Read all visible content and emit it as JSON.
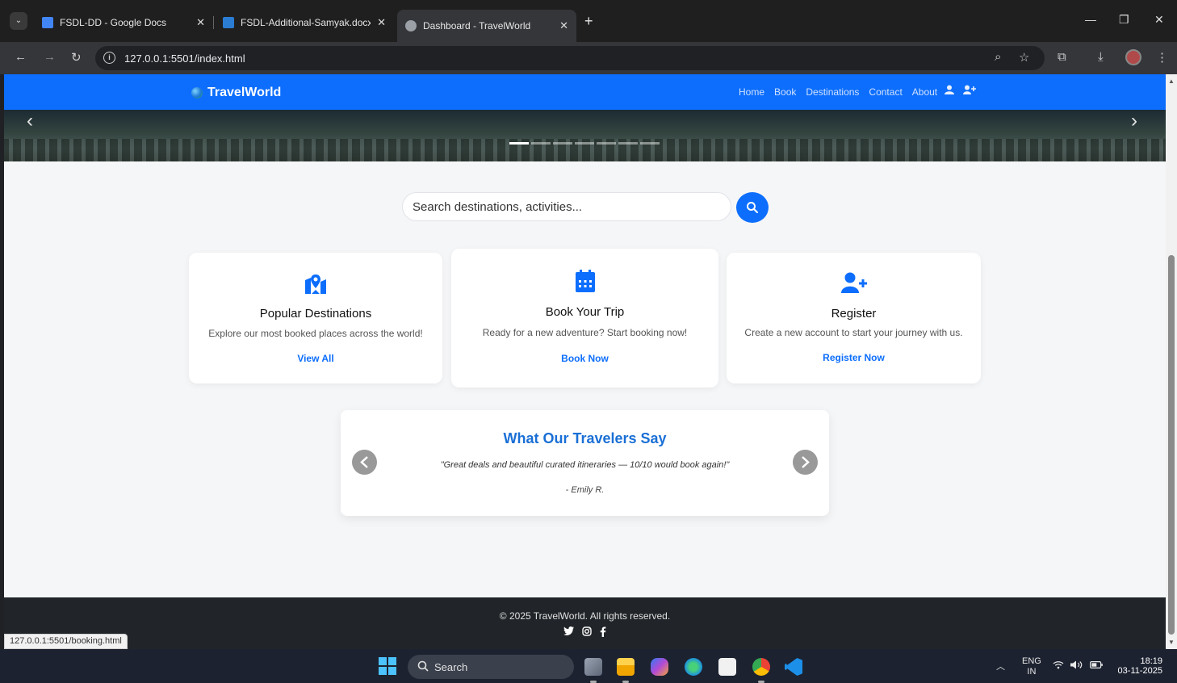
{
  "browser": {
    "tabs": [
      {
        "label": "FSDL-DD - Google Docs",
        "icon": "google-docs-icon"
      },
      {
        "label": "FSDL-Additional-Samyak.docx",
        "icon": "word-icon"
      },
      {
        "label": "Dashboard - TravelWorld",
        "icon": "globe-icon",
        "active": true
      }
    ],
    "url": "127.0.0.1:5501/index.html",
    "status_url": "127.0.0.1:5501/booking.html"
  },
  "page": {
    "brand": "TravelWorld",
    "nav": [
      "Home",
      "Book",
      "Destinations",
      "Contact",
      "About"
    ],
    "hero": {
      "slides": 7,
      "active_slide": 0
    },
    "search": {
      "placeholder": "Search destinations, activities..."
    },
    "cards": [
      {
        "icon": "map-location-icon",
        "title": "Popular Destinations",
        "text": "Explore our most booked places across the world!",
        "link": "View All"
      },
      {
        "icon": "calendar-icon",
        "title": "Book Your Trip",
        "text": "Ready for a new adventure? Start booking now!",
        "link": "Book Now"
      },
      {
        "icon": "user-plus-icon",
        "title": "Register",
        "text": "Create a new account to start your journey with us.",
        "link": "Register Now"
      }
    ],
    "testimonials": {
      "title": "What Our Travelers Say",
      "quote": "\"Great deals and beautiful curated itineraries — 10/10 would book again!\"",
      "author": "- Emily R."
    },
    "footer": {
      "text": "© 2025 TravelWorld. All rights reserved.",
      "socials": [
        "twitter-icon",
        "instagram-icon",
        "facebook-icon"
      ]
    }
  },
  "taskbar": {
    "search": "Search",
    "lang_top": "ENG",
    "lang_bottom": "IN",
    "time": "18:19",
    "date": "03-11-2025"
  },
  "colors": {
    "primary": "#0d6efd",
    "footer": "#212529",
    "page_bg": "#f5f6f8"
  }
}
